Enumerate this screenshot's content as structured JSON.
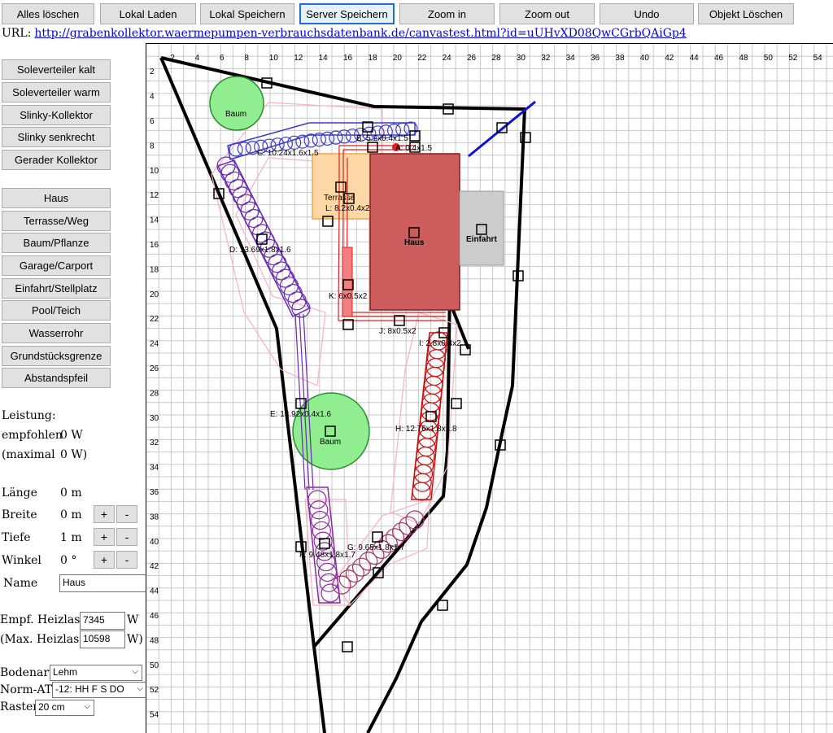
{
  "toolbar": {
    "buttons": [
      "Alles löschen",
      "Lokal Laden",
      "Lokal Speichern",
      "Server Speichern",
      "Zoom in",
      "Zoom out",
      "Undo",
      "Objekt Löschen"
    ],
    "active": "Server Speichern"
  },
  "url": {
    "label": "URL:",
    "link": "http://grabenkollektor.waermepumpen-verbrauchsdatenbank.de/canvastest.html?id=uUHvXD08QwCGrbQAiGp4"
  },
  "sidebar": {
    "collectors": [
      "Soleverteiler kalt",
      "Soleverteiler warm",
      "Slinky-Kollektor",
      "Slinky senkrecht",
      "Gerader Kollektor"
    ],
    "objects": [
      "Haus",
      "Terrasse/Weg",
      "Baum/Pflanze",
      "Garage/Carport",
      "Einfahrt/Stellplatz",
      "Pool/Teich",
      "Wasserrohr",
      "Grundstücksgrenze",
      "Abstandspfeil"
    ]
  },
  "leistung": {
    "title": "Leistung:",
    "empfohlen_label": "empfohlen",
    "empfohlen_value": "0 W",
    "maximal_label": "(maximal",
    "maximal_value": "0 W)"
  },
  "props": {
    "laenge_label": "Länge",
    "laenge_value": "0 m",
    "breite_label": "Breite",
    "breite_value": "0 m",
    "tiefe_label": "Tiefe",
    "tiefe_value": "1 m",
    "winkel_label": "Winkel",
    "winkel_value": "0 °",
    "plus": "+",
    "minus": "-",
    "name_label": "Name",
    "name_value": "Haus"
  },
  "heizlast": {
    "empf_label": "Empf. Heizlast",
    "empf_value": "7345",
    "empf_unit": "W",
    "max_label": "(Max. Heizlast",
    "max_value": "10598",
    "max_unit": "W)"
  },
  "settings": {
    "bodenart_label": "Bodenart",
    "bodenart_value": "Lehm",
    "normat_label": "Norm-AT",
    "normat_value": "-12: HH F S DO",
    "raster_label": "Raster",
    "raster_value": "20 cm"
  },
  "canvas": {
    "x_ticks": [
      2,
      4,
      6,
      8,
      10,
      12,
      14,
      16,
      18,
      20,
      22,
      24,
      26,
      28,
      30,
      32,
      34,
      36,
      38,
      40,
      42,
      44,
      46,
      48,
      50,
      52,
      54
    ],
    "y_ticks": [
      2,
      4,
      6,
      8,
      10,
      12,
      14,
      16,
      18,
      20,
      22,
      24,
      26,
      28,
      30,
      32,
      34,
      36,
      38,
      40,
      42,
      44,
      46,
      48,
      50,
      52,
      54
    ],
    "labels": {
      "haus": "Haus",
      "terrasse": "Terrasse",
      "einfahrt": "Einfahrt",
      "baum": "Baum",
      "B": "B: 5.2x0.4x1.5",
      "A": "A: 0.4x1.5",
      "C": "C: 10.24x1.6x1.5",
      "L": "L: 8.2x0.4x2",
      "D": "D: 13.69x1.8x1.6",
      "K": "K: 6x0.5x2",
      "J": "J: 8x0.5x2",
      "I": "I: 2.8x0.4x2",
      "E": "E: 13.92x0.4x1.6",
      "H": "H: 12.76x1.8x1.8",
      "G": "G: 9.65x1.8x1.7",
      "F": "F: 9.48x1.8x1.7"
    },
    "colors": {
      "house": "#cd5c5c",
      "terrace": "#fdd8a6",
      "driveway": "#cccccc",
      "tree": "#90ee90",
      "purple": "#6a2bb0",
      "blue": "#2a2ad0",
      "red": "#e02020",
      "pink": "#f5b3c2",
      "boundary": "#000000"
    }
  }
}
